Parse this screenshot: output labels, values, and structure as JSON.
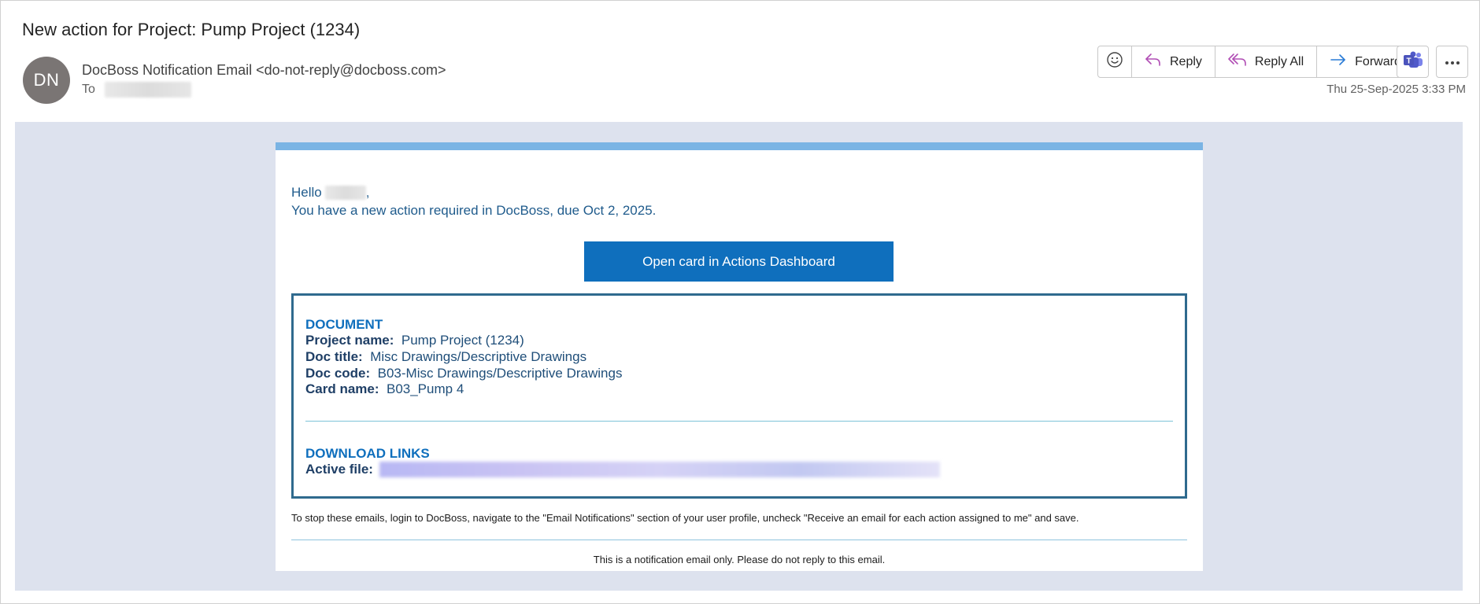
{
  "header": {
    "subject": "New action for Project: Pump Project (1234)",
    "avatar_initials": "DN",
    "avatar_color": "#7a7574",
    "sender": "DocBoss Notification Email <do-not-reply@docboss.com>",
    "to_label": "To",
    "date": "Thu 25-Sep-2025 3:33 PM"
  },
  "toolbar": {
    "emoji_icon": "smiley-icon",
    "reply_label": "Reply",
    "reply_all_label": "Reply All",
    "forward_label": "Forward",
    "teams_icon": "teams-icon",
    "more_icon": "more-icon",
    "reply_color": "#b14fb5",
    "forward_color": "#2a7bd6"
  },
  "email": {
    "greeting": "Hello",
    "greeting_suffix": ",",
    "intro": "You have a new action required in DocBoss, due Oct 2, 2025.",
    "cta_label": "Open card in Actions Dashboard",
    "cta_color": "#0f6fbd",
    "document_heading": "DOCUMENT",
    "fields": [
      {
        "label": "Project name:",
        "value": "Pump Project (1234)"
      },
      {
        "label": "Doc title:",
        "value": "Misc Drawings/Descriptive Drawings"
      },
      {
        "label": "Doc code:",
        "value": "B03-Misc Drawings/Descriptive Drawings"
      },
      {
        "label": "Card name:",
        "value": "B03_Pump 4"
      }
    ],
    "download_heading": "DOWNLOAD LINKS",
    "active_file_label": "Active file:",
    "stop_text": "To stop these emails, login to DocBoss, navigate to the \"Email Notifications\" section of your user profile, uncheck \"Receive an email for each action assigned to me\" and save.",
    "notice": "This is a notification email only. Please do not reply to this email."
  }
}
